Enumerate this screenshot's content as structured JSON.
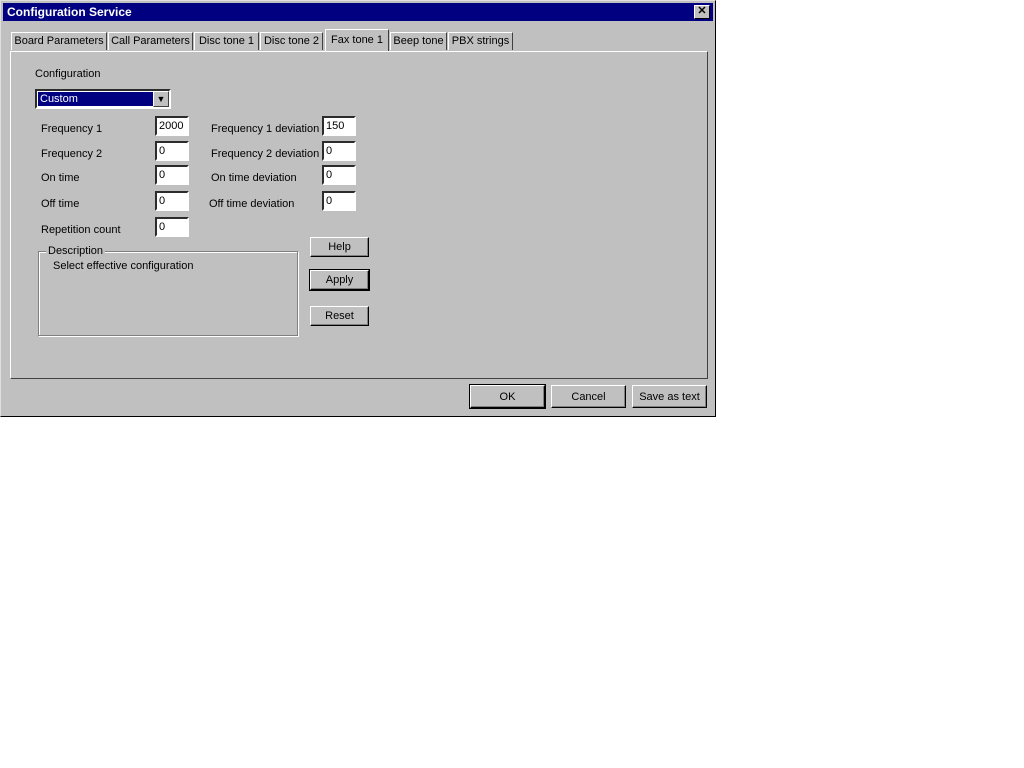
{
  "window": {
    "title": "Configuration Service",
    "close_glyph": "✕"
  },
  "tabs": [
    {
      "label": "Board Parameters"
    },
    {
      "label": "Call Parameters"
    },
    {
      "label": "Disc tone 1"
    },
    {
      "label": "Disc tone 2"
    },
    {
      "label": "Fax tone 1",
      "active": true
    },
    {
      "label": "Beep tone"
    },
    {
      "label": "PBX strings"
    }
  ],
  "config": {
    "label": "Configuration",
    "selected": "Custom",
    "arrow": "▼"
  },
  "fields": {
    "frequency1": {
      "label": "Frequency 1",
      "value": "2000"
    },
    "frequency2": {
      "label": "Frequency 2",
      "value": "0"
    },
    "on_time": {
      "label": "On time",
      "value": "0"
    },
    "off_time": {
      "label": "Off time",
      "value": "0"
    },
    "repetition_count": {
      "label": "Repetition count",
      "value": "0"
    },
    "frequency1_dev": {
      "label": "Frequency 1 deviation",
      "value": "150"
    },
    "frequency2_dev": {
      "label": "Frequency 2 deviation",
      "value": "0"
    },
    "on_time_dev": {
      "label": "On time deviation",
      "value": "0"
    },
    "off_time_dev": {
      "label": "Off time deviation",
      "value": "0"
    }
  },
  "description": {
    "legend": "Description",
    "text": "Select effective configuration"
  },
  "panel_buttons": {
    "help": "Help",
    "apply": "Apply",
    "reset": "Reset"
  },
  "footer_buttons": {
    "ok": "OK",
    "cancel": "Cancel",
    "save_as_text": "Save as text"
  }
}
